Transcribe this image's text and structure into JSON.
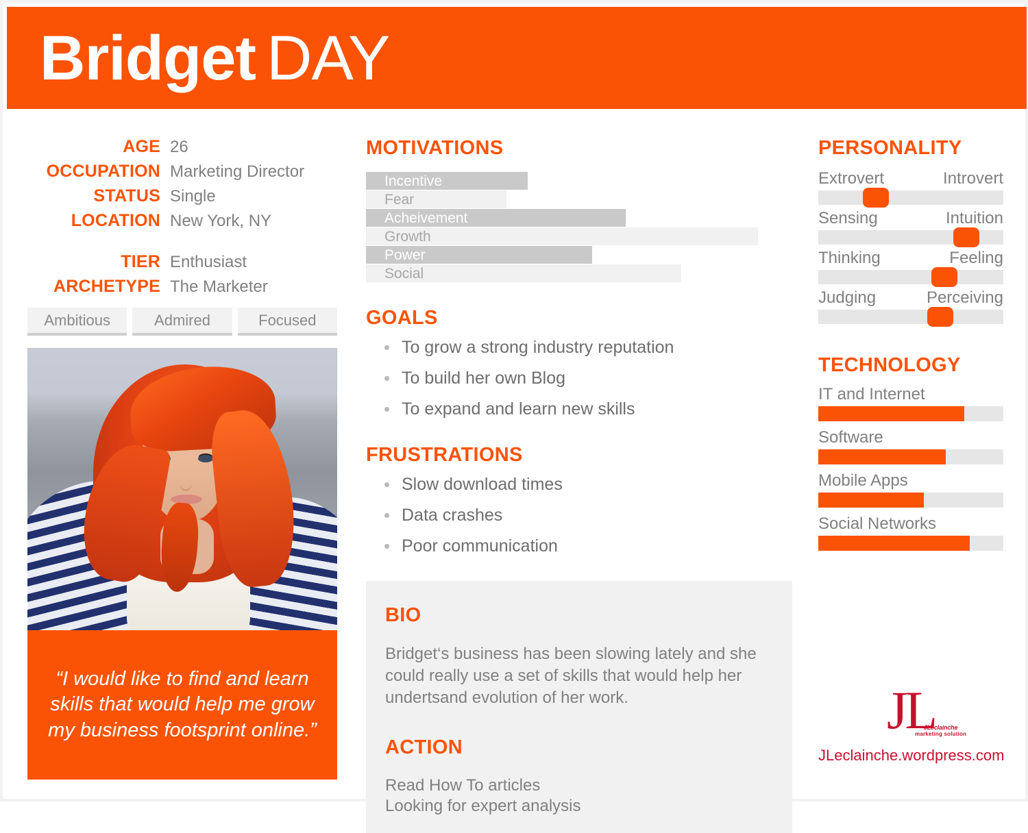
{
  "header": {
    "first_name": "Bridget",
    "last_name": "DAY"
  },
  "colors": {
    "accent_orange": "#fb5305",
    "gray_text": "#808080",
    "bar_dark": "#c9c9c9",
    "bar_light": "#f1f1f1",
    "track_gray": "#e6e6e6",
    "logo_red": "#c8102e"
  },
  "facts": {
    "rows": [
      {
        "label": "AGE",
        "value": "26"
      },
      {
        "label": "OCCUPATION",
        "value": "Marketing Director"
      },
      {
        "label": "STATUS",
        "value": "Single"
      },
      {
        "label": "LOCATION",
        "value": "New York, NY"
      }
    ],
    "rows2": [
      {
        "label": "TIER",
        "value": "Enthusiast"
      },
      {
        "label": "ARCHETYPE",
        "value": "The Marketer"
      }
    ]
  },
  "traits": [
    "Ambitious",
    "Admired",
    "Focused"
  ],
  "quote": "“I would like to find and learn skills that would help me grow my business footsprint online.”",
  "motivations": {
    "title": "MOTIVATIONS",
    "items": [
      {
        "label": "Incentive",
        "percent": 38,
        "style": "dark"
      },
      {
        "label": "Fear",
        "percent": 33,
        "style": "light"
      },
      {
        "label": "Acheivement",
        "percent": 61,
        "style": "dark"
      },
      {
        "label": "Growth",
        "percent": 92,
        "style": "light"
      },
      {
        "label": "Power",
        "percent": 53,
        "style": "dark"
      },
      {
        "label": "Social",
        "percent": 74,
        "style": "light"
      }
    ]
  },
  "goals": {
    "title": "GOALS",
    "items": [
      "To grow a strong industry reputation",
      "To build her own Blog",
      "To expand and learn new skills"
    ]
  },
  "frustrations": {
    "title": "FRUSTRATIONS",
    "items": [
      "Slow download times",
      "Data crashes",
      "Poor communication"
    ]
  },
  "bio": {
    "title": "BIO",
    "text": "Bridget‘s business has been slowing lately and she could really use a set of skills that would help her undertsand evolution of her work."
  },
  "action": {
    "title": "ACTION",
    "text": "Read How To articles\nLooking for expert analysis"
  },
  "personality": {
    "title": "PERSONALITY",
    "rows": [
      {
        "left": "Extrovert",
        "right": "Introvert",
        "position": 31
      },
      {
        "left": "Sensing",
        "right": "Intuition",
        "position": 80
      },
      {
        "left": "Thinking",
        "right": "Feeling",
        "position": 68
      },
      {
        "left": "Judging",
        "right": "Perceiving",
        "position": 66
      }
    ]
  },
  "technology": {
    "title": "TECHNOLOGY",
    "rows": [
      {
        "label": "IT and Internet",
        "percent": 79
      },
      {
        "label": "Software",
        "percent": 69
      },
      {
        "label": "Mobile Apps",
        "percent": 57
      },
      {
        "label": "Social Networks",
        "percent": 82
      }
    ]
  },
  "brand": {
    "monogram": "JL",
    "tagline_script": "JLeclainche",
    "tagline_sub": "marketing solution",
    "url": "JLeclainche.wordpress.com"
  },
  "chart_data": [
    {
      "type": "bar",
      "title": "MOTIVATIONS",
      "orientation": "horizontal",
      "categories": [
        "Incentive",
        "Fear",
        "Acheivement",
        "Growth",
        "Power",
        "Social"
      ],
      "values": [
        38,
        33,
        61,
        92,
        53,
        74
      ],
      "xlabel": "",
      "ylabel": "",
      "xlim": [
        0,
        100
      ],
      "grid": false,
      "legend": "none"
    },
    {
      "type": "bar",
      "title": "TECHNOLOGY",
      "orientation": "horizontal",
      "categories": [
        "IT and Internet",
        "Software",
        "Mobile Apps",
        "Social Networks"
      ],
      "values": [
        79,
        69,
        57,
        82
      ],
      "xlabel": "",
      "ylabel": "",
      "xlim": [
        0,
        100
      ],
      "grid": false,
      "legend": "none"
    },
    {
      "type": "scatter",
      "title": "PERSONALITY",
      "categories": [
        "Extrovert-Introvert",
        "Sensing-Intuition",
        "Thinking-Feeling",
        "Judging-Perceiving"
      ],
      "values": [
        31,
        80,
        68,
        66
      ],
      "xlabel": "",
      "ylabel": "",
      "xlim": [
        0,
        100
      ],
      "grid": false,
      "legend": "none"
    }
  ]
}
